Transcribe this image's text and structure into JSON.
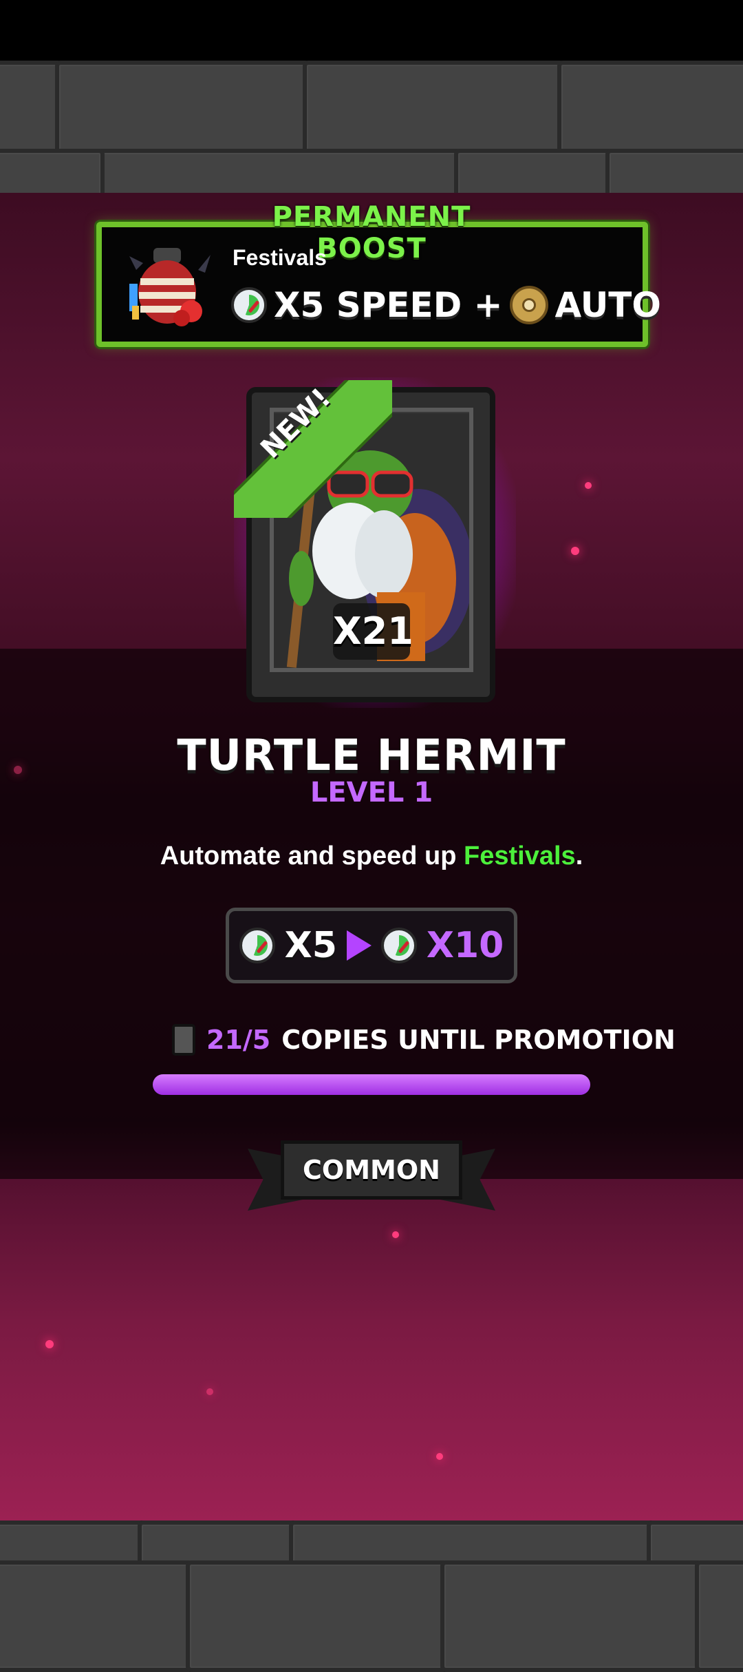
{
  "banner": {
    "title": "PERMANENT BOOST",
    "subtitle": "Festivals",
    "speed_text": "X5 SPEED +",
    "auto_text": "AUTO",
    "icons": [
      "lantern-icon",
      "speed-gauge-icon",
      "auto-gear-icon"
    ]
  },
  "card": {
    "badge": "NEW!",
    "count": "X21",
    "name": "TURTLE HERMIT",
    "level": "LEVEL 1",
    "description_prefix": "Automate and speed up ",
    "description_highlight": "Festivals",
    "description_suffix": "."
  },
  "speed": {
    "from": "X5",
    "to": "X10"
  },
  "promotion": {
    "copies": "21/5",
    "label": "COPIES UNTIL PROMOTION",
    "progress": 1.0
  },
  "rarity": "COMMON",
  "colors": {
    "accent_purple": "#c469ff",
    "accent_green": "#4cf03b",
    "banner_border": "#6ec12a"
  }
}
